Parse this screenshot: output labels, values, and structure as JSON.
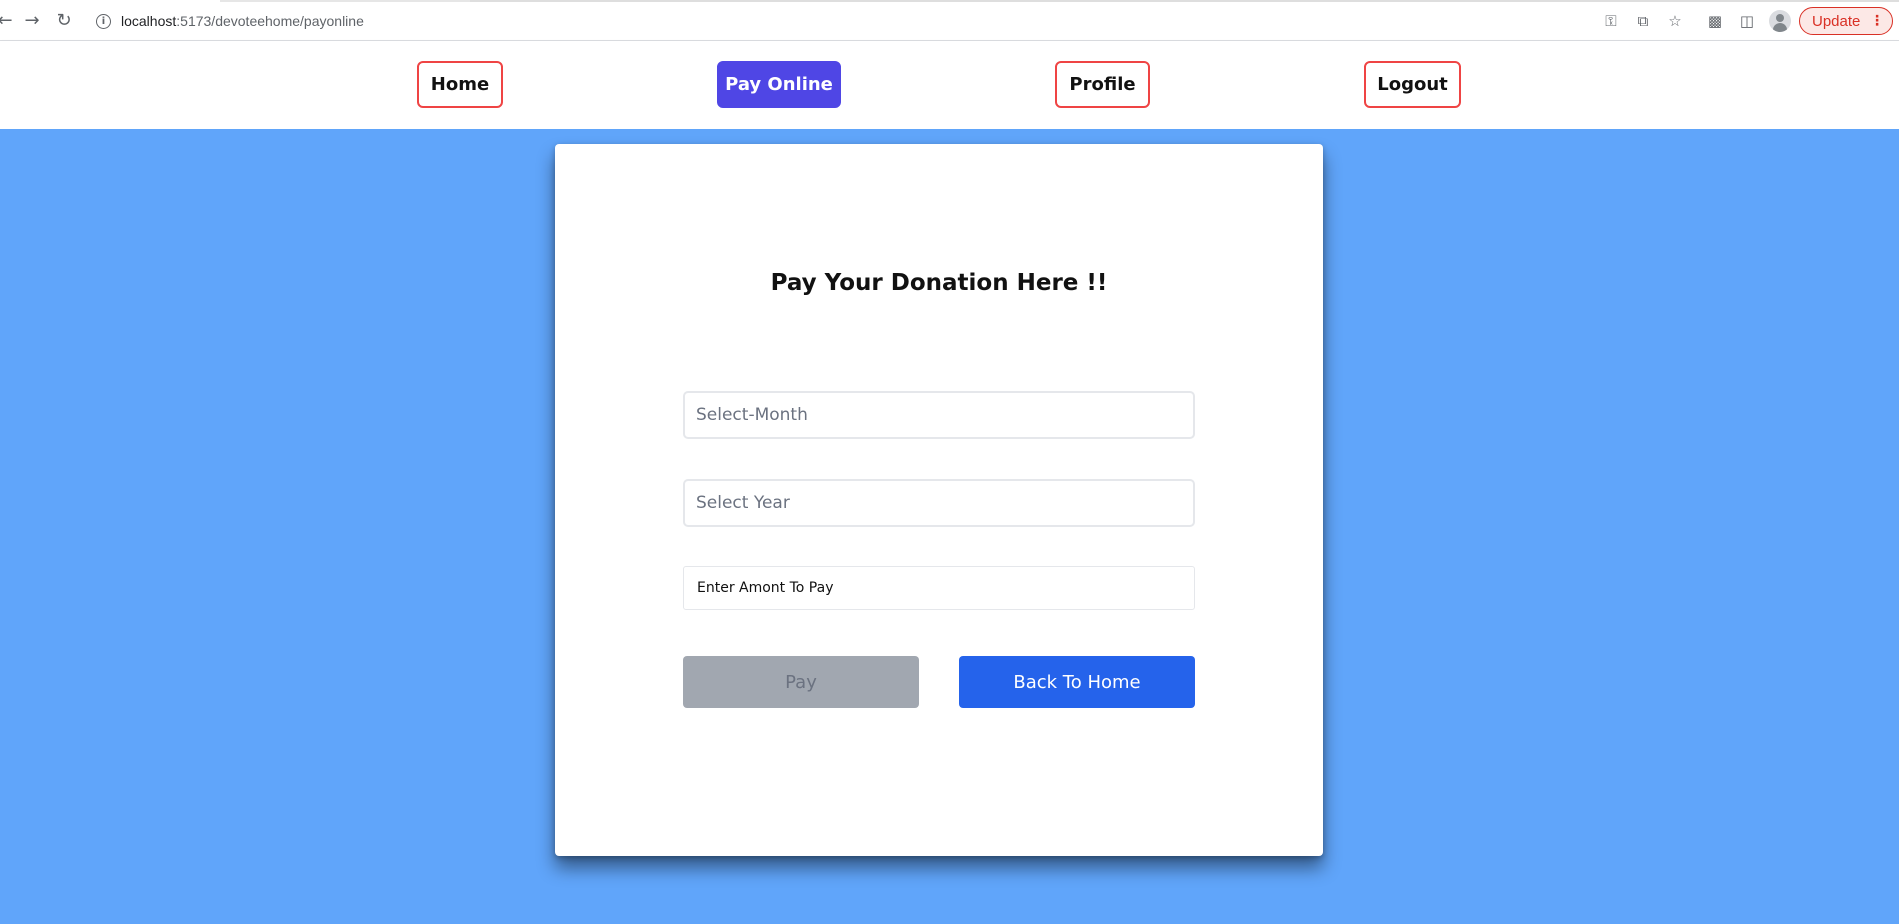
{
  "browser": {
    "url_host": "localhost",
    "url_path": ":5173/devoteehome/payonline",
    "update_label": "Update"
  },
  "nav": {
    "items": [
      {
        "label": "Home",
        "active": false
      },
      {
        "label": "Pay Online",
        "active": true
      },
      {
        "label": "Profile",
        "active": false
      },
      {
        "label": "Logout",
        "active": false
      }
    ]
  },
  "form": {
    "title": "Pay Your Donation Here !!",
    "month_placeholder": "Select-Month",
    "year_placeholder": "Select Year",
    "amount_placeholder": "Enter Amont To Pay",
    "pay_label": "Pay",
    "back_label": "Back To Home"
  },
  "colors": {
    "page_background": "#60a5fa",
    "active_nav": "#4f46e5",
    "nav_border": "#ef4444",
    "back_button": "#2563eb",
    "pay_button_disabled": "#a1a7b0"
  }
}
